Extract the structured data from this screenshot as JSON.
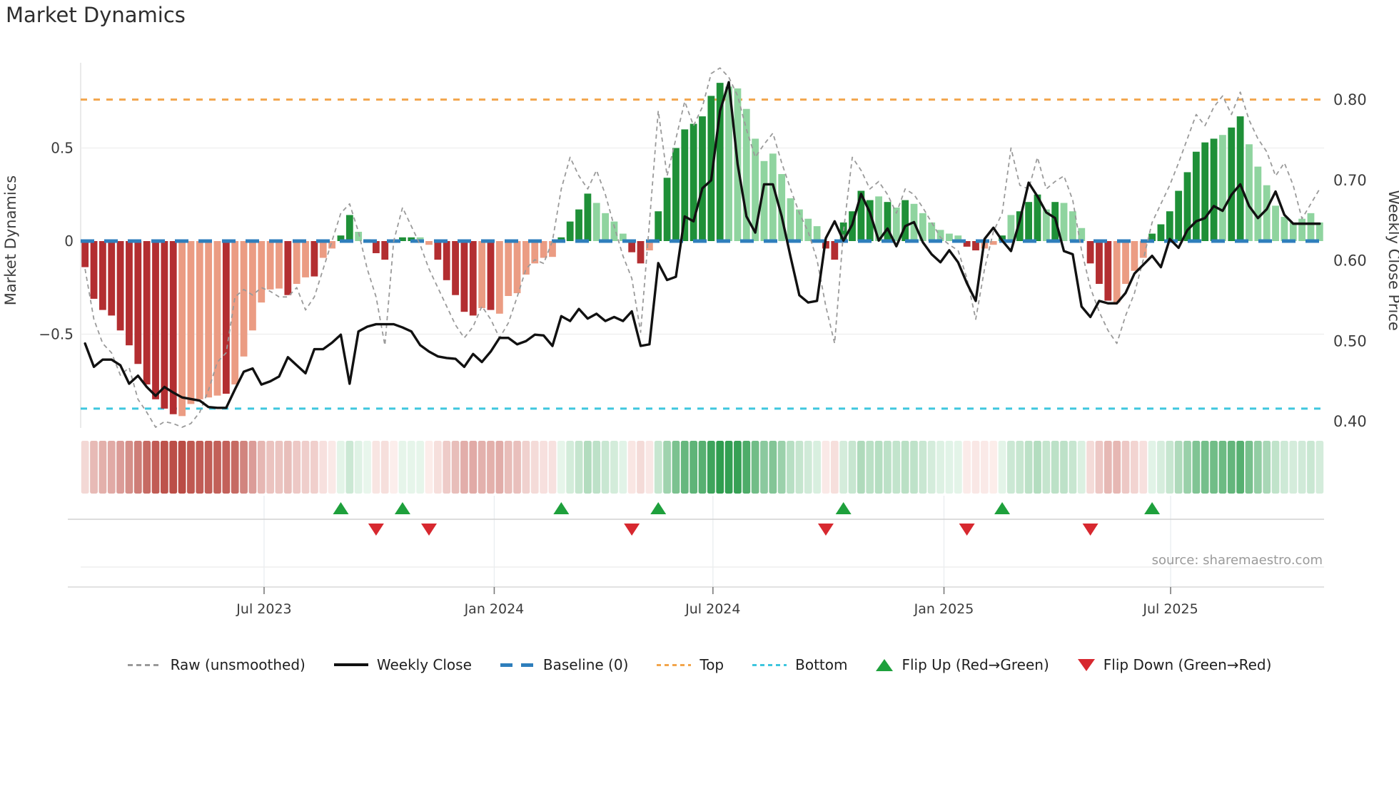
{
  "title": "Market Dynamics",
  "source": "source: sharemaestro.com",
  "axes": {
    "left": {
      "label": "Market Dynamics",
      "ticks": [
        {
          "v": 0.5,
          "label": "0.5"
        },
        {
          "v": 0.0,
          "label": "0"
        },
        {
          "v": -0.5,
          "label": "−0.5"
        }
      ]
    },
    "right": {
      "label": "Weekly Close Price",
      "ticks": [
        {
          "p": 0.8,
          "label": "0.80"
        },
        {
          "p": 0.7,
          "label": "0.70"
        },
        {
          "p": 0.6,
          "label": "0.60"
        },
        {
          "p": 0.5,
          "label": "0.50"
        },
        {
          "p": 0.4,
          "label": "0.40"
        }
      ]
    },
    "x": {
      "tick_labels": [
        "Jul 2023",
        "Jan 2024",
        "Jul 2024",
        "Jan 2025",
        "Jul 2025"
      ],
      "tick_week_positions": [
        20.3,
        46.4,
        71.2,
        97.4,
        123.1
      ]
    }
  },
  "colors": {
    "bar": {
      "dr": "#b32e31",
      "lr": "#eb9c83",
      "dg": "#1f9038",
      "lg": "#8fd49f"
    },
    "raw_line": "#9a9a9a",
    "price_line": "#111111",
    "baseline": "#2e7ebc",
    "top_line": "#f2a54c",
    "bottom_line": "#3ec6de",
    "flip_up": "#1ea03c",
    "flip_down": "#d7282f",
    "heat_neg_hi": "#b6423a",
    "heat_neg_lo": "#fdf0ee",
    "heat_pos_lo": "#eaf7ee",
    "heat_pos_hi": "#2f9d4f"
  },
  "legend": {
    "items": [
      {
        "label": "Raw (unsmoothed)",
        "type": "raw"
      },
      {
        "label": "Weekly Close",
        "type": "close"
      },
      {
        "label": "Baseline (0)",
        "type": "base"
      },
      {
        "label": "Top",
        "type": "top"
      },
      {
        "label": "Bottom",
        "type": "bottom"
      },
      {
        "label": "Flip Up (Red→Green)",
        "type": "up"
      },
      {
        "label": "Flip Down (Green→Red)",
        "type": "down"
      }
    ]
  },
  "chart_data": {
    "type": "bar",
    "title": "Market Dynamics",
    "ylabel_left": "Market Dynamics",
    "ylabel_right": "Weekly Close Price",
    "weeks": 141,
    "left_axis_range": [
      -1.05,
      0.97
    ],
    "right_axis_range": [
      0.355,
      0.835
    ],
    "reference_lines": {
      "baseline": 0.0,
      "top": 0.76,
      "bottom": -0.9
    },
    "bars": {
      "name": "Market Dynamics (smoothed bars)",
      "values": [
        -0.14,
        -0.31,
        -0.37,
        -0.4,
        -0.48,
        -0.56,
        -0.66,
        -0.77,
        -0.85,
        -0.9,
        -0.93,
        -0.94,
        -0.875,
        -0.85,
        -0.84,
        -0.83,
        -0.82,
        -0.77,
        -0.62,
        -0.48,
        -0.33,
        -0.26,
        -0.255,
        -0.29,
        -0.23,
        -0.195,
        -0.19,
        -0.09,
        -0.04,
        0.03,
        0.14,
        0.05,
        0.01,
        -0.065,
        -0.1,
        -0.01,
        0.02,
        0.02,
        0.02,
        -0.02,
        -0.1,
        -0.21,
        -0.29,
        -0.38,
        -0.4,
        -0.36,
        -0.37,
        -0.39,
        -0.295,
        -0.28,
        -0.18,
        -0.12,
        -0.09,
        -0.085,
        0.02,
        0.105,
        0.17,
        0.255,
        0.205,
        0.15,
        0.105,
        0.04,
        -0.06,
        -0.12,
        -0.05,
        0.16,
        0.34,
        0.5,
        0.6,
        0.63,
        0.67,
        0.78,
        0.85,
        0.83,
        0.82,
        0.71,
        0.55,
        0.43,
        0.47,
        0.36,
        0.23,
        0.17,
        0.12,
        0.08,
        -0.04,
        -0.1,
        0.1,
        0.16,
        0.27,
        0.22,
        0.24,
        0.21,
        0.18,
        0.22,
        0.2,
        0.15,
        0.1,
        0.06,
        0.04,
        0.03,
        -0.03,
        -0.05,
        -0.04,
        -0.02,
        0.03,
        0.14,
        0.16,
        0.21,
        0.25,
        0.17,
        0.21,
        0.205,
        0.16,
        0.07,
        -0.12,
        -0.23,
        -0.32,
        -0.33,
        -0.23,
        -0.16,
        -0.09,
        0.04,
        0.09,
        0.16,
        0.27,
        0.37,
        0.48,
        0.53,
        0.55,
        0.57,
        0.61,
        0.67,
        0.52,
        0.4,
        0.3,
        0.19,
        0.13,
        0.1,
        0.12,
        0.15,
        0.1
      ],
      "colors": [
        "dr",
        "dr",
        "dr",
        "dr",
        "dr",
        "dr",
        "dr",
        "dr",
        "dr",
        "dr",
        "dr",
        "lr",
        "lr",
        "lr",
        "lr",
        "lr",
        "dr",
        "lr",
        "lr",
        "lr",
        "lr",
        "lr",
        "lr",
        "dr",
        "lr",
        "lr",
        "dr",
        "lr",
        "lr",
        "dg",
        "dg",
        "lg",
        "lg",
        "dr",
        "dr",
        "lr",
        "dg",
        "dg",
        "lg",
        "lr",
        "dr",
        "dr",
        "dr",
        "dr",
        "dr",
        "lr",
        "dr",
        "lr",
        "lr",
        "lr",
        "lr",
        "lr",
        "lr",
        "lr",
        "dg",
        "dg",
        "dg",
        "dg",
        "lg",
        "lg",
        "lg",
        "lg",
        "dr",
        "dr",
        "lr",
        "dg",
        "dg",
        "dg",
        "dg",
        "dg",
        "dg",
        "dg",
        "dg",
        "lg",
        "lg",
        "lg",
        "lg",
        "lg",
        "lg",
        "lg",
        "lg",
        "lg",
        "lg",
        "lg",
        "dr",
        "dr",
        "dg",
        "dg",
        "dg",
        "dg",
        "lg",
        "dg",
        "lg",
        "dg",
        "lg",
        "lg",
        "lg",
        "lg",
        "lg",
        "lg",
        "dr",
        "dr",
        "lr",
        "lr",
        "dg",
        "lg",
        "dg",
        "dg",
        "dg",
        "lg",
        "dg",
        "lg",
        "lg",
        "lg",
        "dr",
        "dr",
        "dr",
        "lr",
        "lr",
        "lr",
        "lr",
        "dg",
        "dg",
        "dg",
        "dg",
        "dg",
        "dg",
        "dg",
        "dg",
        "lg",
        "dg",
        "dg",
        "lg",
        "lg",
        "lg",
        "lg",
        "lg",
        "lg",
        "lg",
        "lg",
        "lg"
      ]
    },
    "raw": {
      "name": "Raw (unsmoothed)",
      "values": [
        -0.15,
        -0.42,
        -0.55,
        -0.6,
        -0.72,
        -0.68,
        -0.85,
        -0.92,
        -1.0,
        -0.97,
        -0.98,
        -1.0,
        -0.98,
        -0.92,
        -0.8,
        -0.65,
        -0.6,
        -0.3,
        -0.26,
        -0.29,
        -0.25,
        -0.27,
        -0.3,
        -0.3,
        -0.25,
        -0.37,
        -0.3,
        -0.15,
        0.0,
        0.15,
        0.2,
        0.05,
        -0.15,
        -0.3,
        -0.56,
        0.0,
        0.18,
        0.08,
        -0.02,
        -0.15,
        -0.25,
        -0.35,
        -0.45,
        -0.52,
        -0.46,
        -0.35,
        -0.42,
        -0.52,
        -0.44,
        -0.3,
        -0.15,
        -0.1,
        -0.12,
        0.0,
        0.28,
        0.45,
        0.35,
        0.28,
        0.38,
        0.25,
        0.08,
        -0.08,
        -0.2,
        -0.49,
        0.1,
        0.7,
        0.35,
        0.55,
        0.75,
        0.62,
        0.72,
        0.9,
        0.93,
        0.88,
        0.78,
        0.6,
        0.45,
        0.52,
        0.58,
        0.42,
        0.28,
        0.15,
        0.05,
        -0.1,
        -0.35,
        -0.55,
        0.05,
        0.45,
        0.38,
        0.28,
        0.32,
        0.25,
        0.15,
        0.28,
        0.25,
        0.18,
        0.1,
        0.02,
        -0.02,
        -0.05,
        -0.2,
        -0.42,
        -0.15,
        0.05,
        0.15,
        0.5,
        0.3,
        0.28,
        0.45,
        0.28,
        0.32,
        0.35,
        0.22,
        -0.05,
        -0.25,
        -0.38,
        -0.48,
        -0.55,
        -0.4,
        -0.28,
        -0.1,
        0.1,
        0.2,
        0.3,
        0.42,
        0.55,
        0.68,
        0.62,
        0.72,
        0.78,
        0.68,
        0.8,
        0.65,
        0.55,
        0.48,
        0.35,
        0.42,
        0.3,
        0.12,
        0.2,
        0.28
      ]
    },
    "price": {
      "name": "Weekly Close",
      "axis": "right",
      "values": [
        0.497,
        0.468,
        0.477,
        0.477,
        0.47,
        0.447,
        0.457,
        0.443,
        0.432,
        0.443,
        0.436,
        0.43,
        0.428,
        0.426,
        0.418,
        0.417,
        0.417,
        0.44,
        0.462,
        0.466,
        0.446,
        0.45,
        0.456,
        0.48,
        0.47,
        0.46,
        0.49,
        0.49,
        0.498,
        0.508,
        0.447,
        0.512,
        0.518,
        0.521,
        0.521,
        0.521,
        0.517,
        0.512,
        0.495,
        0.487,
        0.481,
        0.479,
        0.478,
        0.468,
        0.484,
        0.474,
        0.487,
        0.504,
        0.504,
        0.496,
        0.5,
        0.508,
        0.507,
        0.494,
        0.531,
        0.525,
        0.54,
        0.528,
        0.534,
        0.525,
        0.53,
        0.525,
        0.537,
        0.494,
        0.496,
        0.597,
        0.576,
        0.58,
        0.655,
        0.649,
        0.69,
        0.7,
        0.786,
        0.822,
        0.72,
        0.655,
        0.635,
        0.695,
        0.695,
        0.655,
        0.605,
        0.557,
        0.548,
        0.55,
        0.628,
        0.649,
        0.625,
        0.645,
        0.683,
        0.66,
        0.625,
        0.64,
        0.618,
        0.643,
        0.648,
        0.623,
        0.608,
        0.598,
        0.613,
        0.598,
        0.572,
        0.55,
        0.627,
        0.641,
        0.625,
        0.612,
        0.65,
        0.697,
        0.68,
        0.66,
        0.653,
        0.612,
        0.608,
        0.543,
        0.53,
        0.55,
        0.547,
        0.547,
        0.56,
        0.584,
        0.595,
        0.606,
        0.592,
        0.627,
        0.616,
        0.638,
        0.649,
        0.653,
        0.668,
        0.662,
        0.682,
        0.695,
        0.668,
        0.653,
        0.664,
        0.686,
        0.657,
        0.646,
        0.646,
        0.646,
        0.646
      ]
    },
    "flips": {
      "up_weeks": [
        29,
        36,
        54,
        65,
        86,
        104,
        121
      ],
      "down_weeks": [
        33,
        39,
        62,
        84,
        100,
        114
      ]
    },
    "heatmap": {
      "source": "bars",
      "note": "strip below main plot, color = bar value on red-green scale"
    }
  }
}
